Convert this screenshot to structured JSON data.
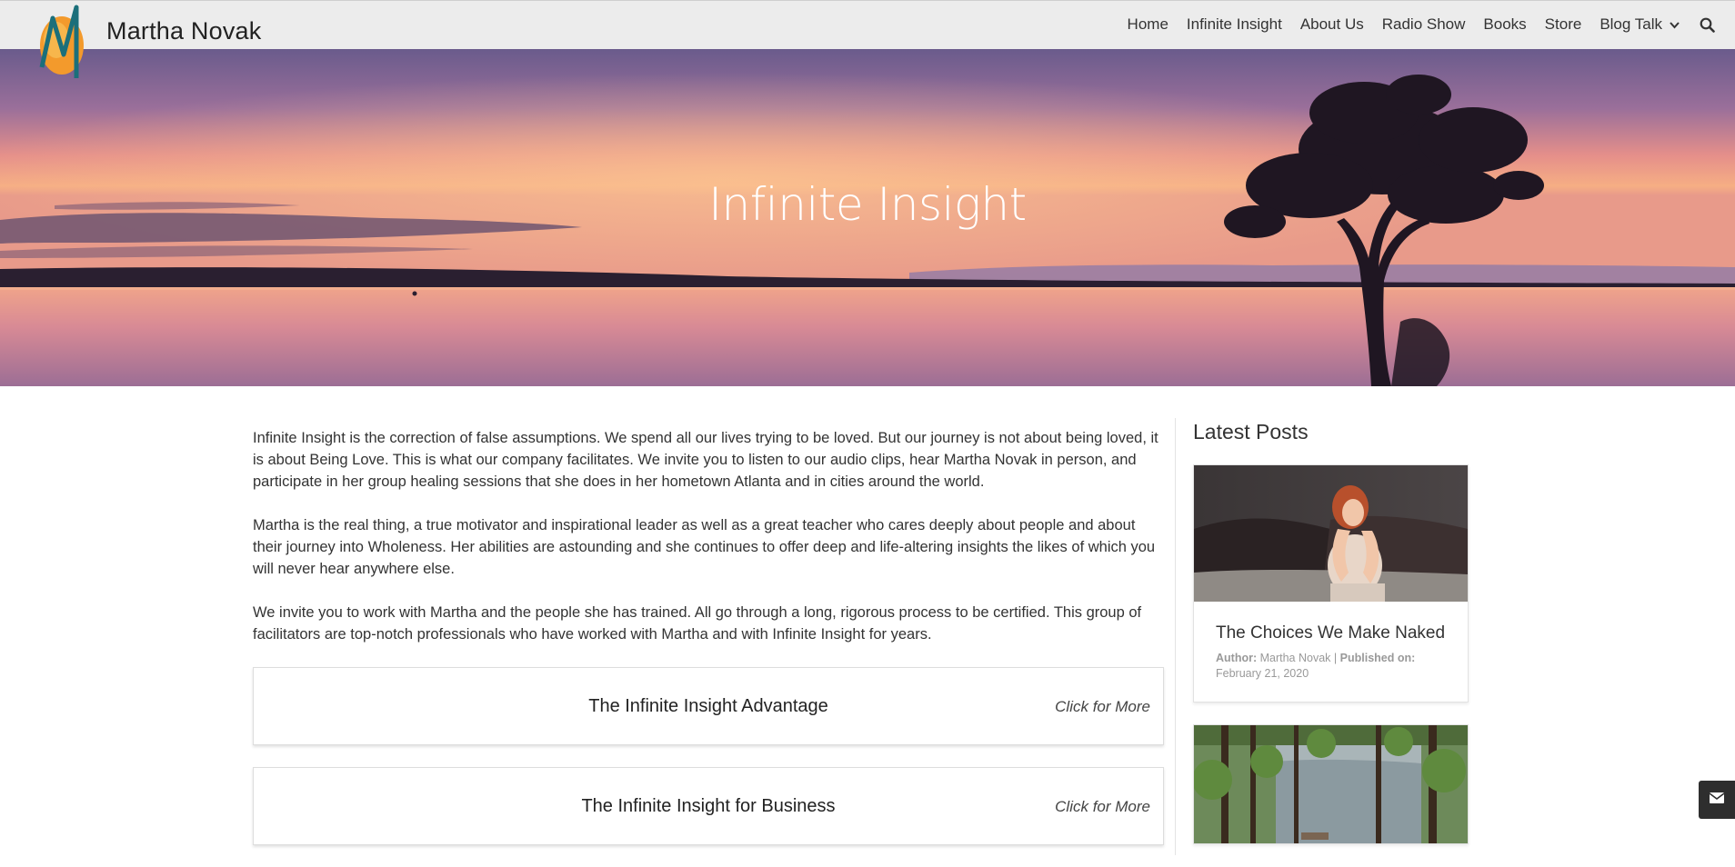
{
  "header": {
    "brand": "Martha Novak",
    "nav": [
      "Home",
      "Infinite Insight",
      "About Us",
      "Radio Show",
      "Books",
      "Store",
      "Blog Talk"
    ],
    "icons": {
      "dropdown": "chevron-down-icon",
      "search": "search-icon"
    }
  },
  "hero": {
    "title": "Infinite Insight"
  },
  "main": {
    "paragraphs": [
      "Infinite Insight is the correction of false assumptions. We spend all our lives trying to be loved. But our journey is not about being loved, it is about Being Love. This is what our company facilitates. We invite you to listen to our audio clips, hear Martha Novak in person, and participate in her group healing sessions that she does in her hometown Atlanta and in cities around the world.",
      "Martha is the real thing, a true motivator and inspirational leader as well as a great teacher who cares deeply about people and about their journey into Wholeness. Her abilities are astounding and she continues to offer deep and life-altering insights the likes of which you will never hear anywhere else.",
      "We invite you to work with Martha and the people she has trained. All go through a long, rigorous process to be certified. This group of facilitators are top-notch professionals who have worked with Martha and with Infinite Insight for years."
    ],
    "accordions": [
      {
        "title": "The Infinite Insight Advantage",
        "more": "Click for More"
      },
      {
        "title": "The Infinite Insight for Business",
        "more": "Click for More"
      }
    ]
  },
  "sidebar": {
    "title": "Latest Posts",
    "posts": [
      {
        "title": "The Choices We Make Naked",
        "author_label": "Author:",
        "author": "Martha Novak",
        "published_label": "Published on:",
        "date": "February 21, 2020"
      }
    ]
  },
  "colors": {
    "header_bg": "#ececec",
    "sky_top": "#6a5b8c",
    "sky_glow": "#f3a67e",
    "text": "#333333",
    "mail_button": "#2e2e2e"
  }
}
